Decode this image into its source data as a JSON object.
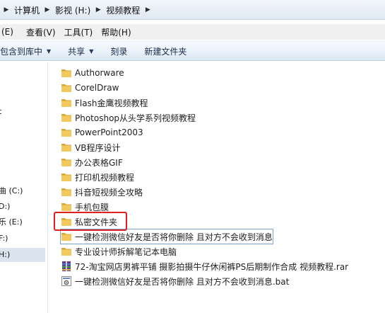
{
  "address": {
    "crumbs": [
      "计算机",
      "影视 (H:)",
      "视频教程"
    ]
  },
  "menu": {
    "items": [
      "(E)",
      "查看(V)",
      "工具(T)",
      "帮助(H)"
    ]
  },
  "toolbar": {
    "include_label": "包含到库中",
    "share_label": "共享",
    "burn_label": "刻录",
    "new_folder_label": "新建文件夹"
  },
  "nav": {
    "items": [
      {
        "label": "t"
      },
      {
        "label": "曲 (C:)"
      },
      {
        "label": "D:)"
      },
      {
        "label": "乐 (E:)"
      },
      {
        "label": "F:)"
      },
      {
        "label": "H:)"
      }
    ]
  },
  "files": [
    {
      "name": "Authorware",
      "icon": "folder-icon"
    },
    {
      "name": "CorelDraw",
      "icon": "folder-icon"
    },
    {
      "name": "Flash金鹰视频教程",
      "icon": "folder-icon"
    },
    {
      "name": "Photoshop从头学系列视频教程",
      "icon": "folder-icon"
    },
    {
      "name": "PowerPoint2003",
      "icon": "folder-icon"
    },
    {
      "name": "VB程序设计",
      "icon": "folder-icon"
    },
    {
      "name": "办公表格GIF",
      "icon": "folder-icon"
    },
    {
      "name": "打印机视频教程",
      "icon": "folder-icon"
    },
    {
      "name": "抖音短视频全攻略",
      "icon": "folder-icon"
    },
    {
      "name": "手机包膜",
      "icon": "folder-icon"
    },
    {
      "name": "私密文件夹",
      "icon": "folder-icon"
    },
    {
      "name": "一键检测微信好友是否将你删除 且对方不会收到消息",
      "icon": "folder-icon"
    },
    {
      "name": "专业设计师拆解笔记本电脑",
      "icon": "folder-icon"
    },
    {
      "name": "72-淘宝网店男裤平铺 摄影拍摄牛仔休闲裤PS后期制作合成 视频教程.rar",
      "icon": "rar-archive-icon"
    },
    {
      "name": "一键检测微信好友是否将你删除 且对方不会收到消息.bat",
      "icon": "bat-file-icon"
    }
  ],
  "colors": {
    "folder": "#e8b84a",
    "highlight": "#e02020",
    "selection": "#dbe4ee"
  }
}
